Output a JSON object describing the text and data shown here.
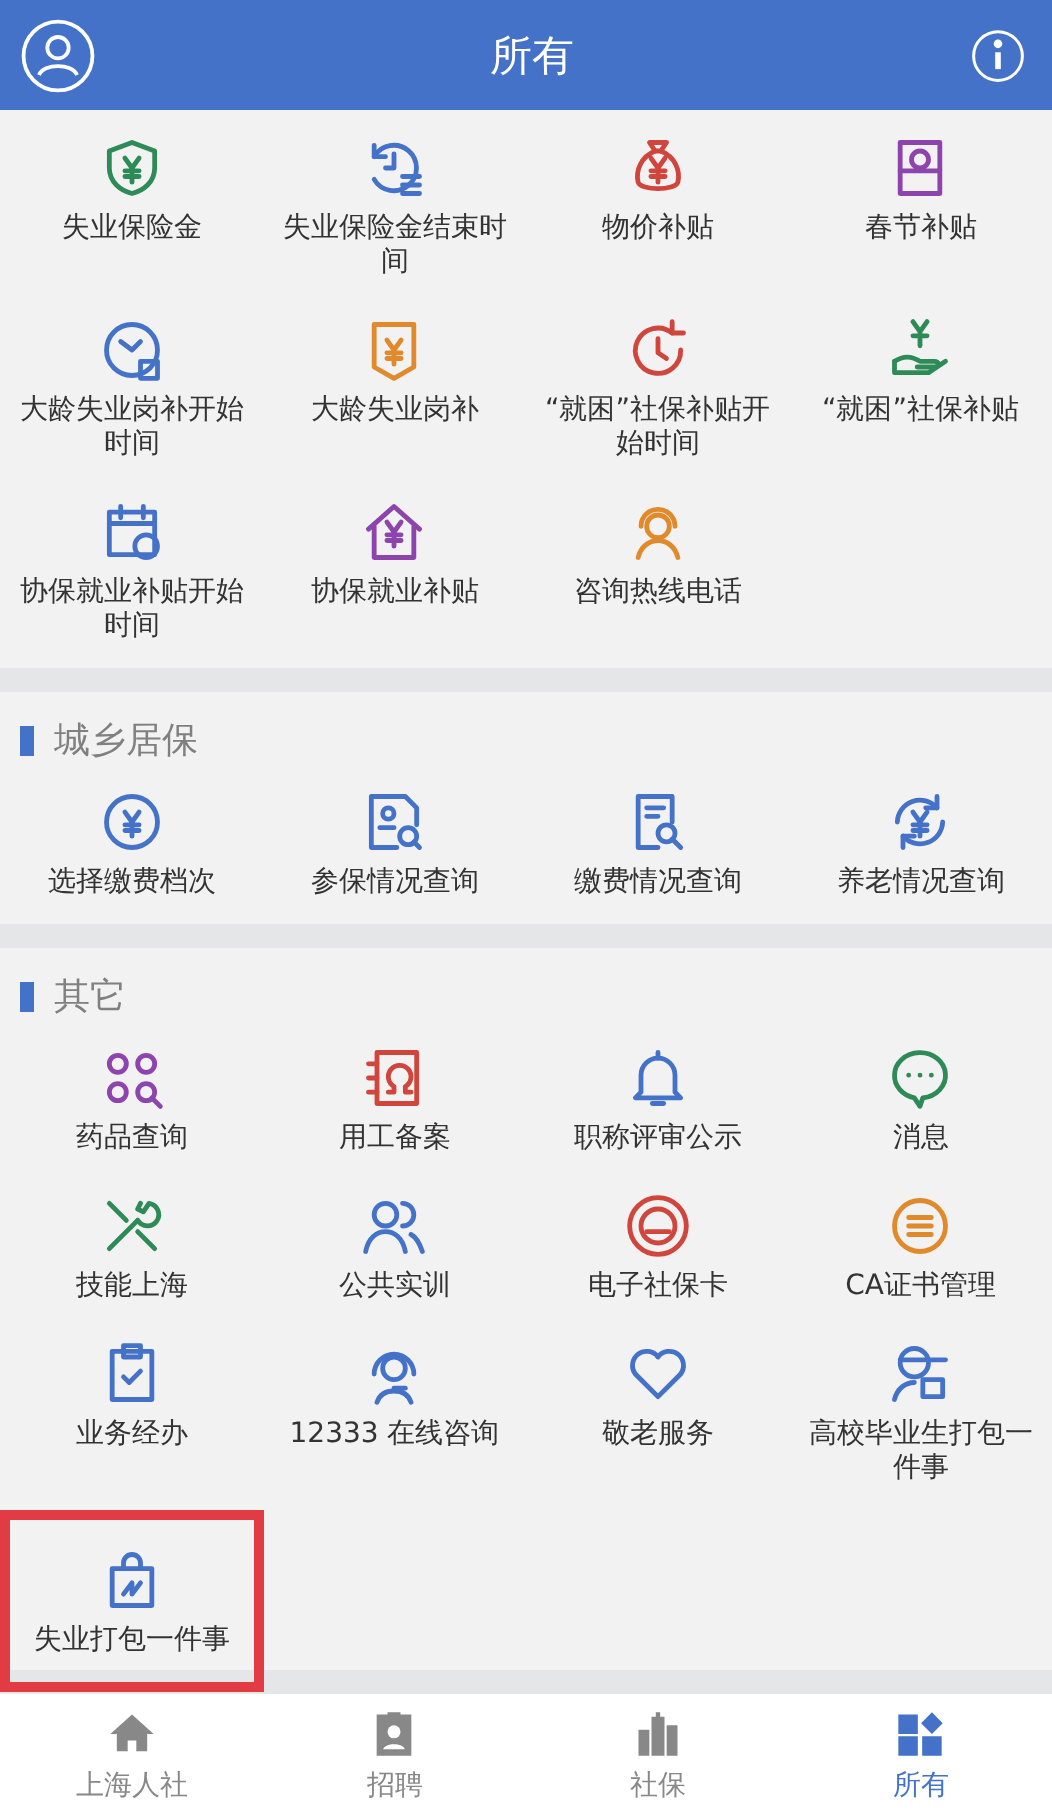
{
  "header": {
    "title": "所有"
  },
  "sections": [
    {
      "items": [
        {
          "label": "失业保险金",
          "color": "#2e8b57"
        },
        {
          "label": "失业保险金结束时间",
          "color": "#4472c8"
        },
        {
          "label": "物价补贴",
          "color": "#d0453c"
        },
        {
          "label": "春节补贴",
          "color": "#8e44ad"
        },
        {
          "label": "大龄失业岗补开始时间",
          "color": "#4472c8"
        },
        {
          "label": "大龄失业岗补",
          "color": "#e08a2c"
        },
        {
          "label": "“就困”社保补贴开始时间",
          "color": "#d0453c"
        },
        {
          "label": "“就困”社保补贴",
          "color": "#2e8b57"
        },
        {
          "label": "协保就业补贴开始时间",
          "color": "#4472c8"
        },
        {
          "label": "协保就业补贴",
          "color": "#8e44ad"
        },
        {
          "label": "咨询热线电话",
          "color": "#e08a2c"
        }
      ]
    },
    {
      "title": "城乡居保",
      "items": [
        {
          "label": "选择缴费档次",
          "color": "#4472c8"
        },
        {
          "label": "参保情况查询",
          "color": "#4472c8"
        },
        {
          "label": "缴费情况查询",
          "color": "#4472c8"
        },
        {
          "label": "养老情况查询",
          "color": "#4472c8"
        }
      ]
    },
    {
      "title": "其它",
      "items": [
        {
          "label": "药品查询",
          "color": "#8e44ad"
        },
        {
          "label": "用工备案",
          "color": "#d0453c"
        },
        {
          "label": "职称评审公示",
          "color": "#4472c8"
        },
        {
          "label": "消息",
          "color": "#2e8b57"
        },
        {
          "label": "技能上海",
          "color": "#2e8b57"
        },
        {
          "label": "公共实训",
          "color": "#4472c8"
        },
        {
          "label": "电子社保卡",
          "color": "#d0453c"
        },
        {
          "label": "CA证书管理",
          "color": "#e08a2c"
        },
        {
          "label": "业务经办",
          "color": "#4472c8"
        },
        {
          "label": "12333 在线咨询",
          "color": "#4472c8"
        },
        {
          "label": "敬老服务",
          "color": "#4472c8"
        },
        {
          "label": "高校毕业生打包一件事",
          "color": "#4472c8"
        },
        {
          "label": "失业打包一件事",
          "color": "#4472c8",
          "highlighted": true
        }
      ]
    }
  ],
  "tabbar": [
    {
      "label": "上海人社",
      "selected": false
    },
    {
      "label": "招聘",
      "selected": false
    },
    {
      "label": "社保",
      "selected": false
    },
    {
      "label": "所有",
      "selected": true
    }
  ]
}
